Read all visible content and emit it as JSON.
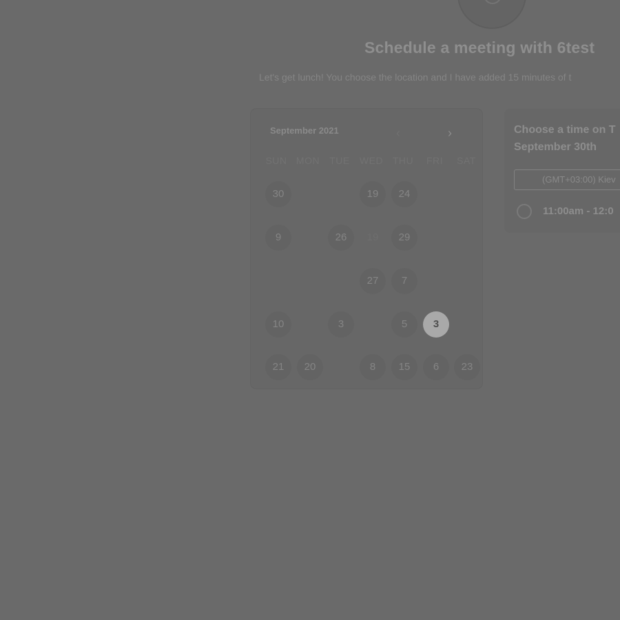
{
  "header": {
    "title": "Schedule a meeting with 6test",
    "subtitle": "Let's get lunch! You choose the location and I have added 15 minutes of t"
  },
  "calendar": {
    "month_label": "September 2021",
    "prev_icon": "chevron-left-icon",
    "next_icon": "chevron-right-icon",
    "prev_glyph": "‹",
    "next_glyph": "›",
    "weekdays": [
      "SUN",
      "MON",
      "TUE",
      "WED",
      "THU",
      "FRI",
      "SAT"
    ],
    "rows": [
      [
        "30",
        "",
        "",
        "19",
        "24",
        "",
        ""
      ],
      [
        "9",
        "",
        "26",
        "19",
        "29",
        "",
        ""
      ],
      [
        "",
        "",
        "",
        "27",
        "7",
        "",
        ""
      ],
      [
        "10",
        "",
        "3",
        "",
        "5",
        "3",
        ""
      ],
      [
        "21",
        "20",
        "",
        "8",
        "15",
        "6",
        "23"
      ]
    ],
    "selected_day": "3"
  },
  "times": {
    "heading_line1": "Choose a time on T",
    "heading_line2": "September 30th",
    "timezone": "(GMT+03:00) Kiev",
    "slot_label": "11:00am - 12:0"
  }
}
